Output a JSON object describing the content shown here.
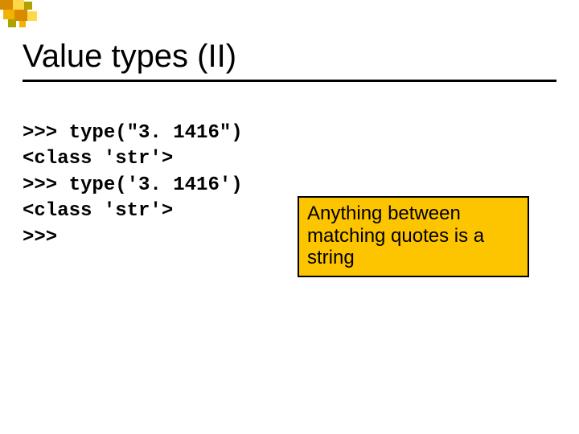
{
  "title": "Value types (II)",
  "code": {
    "line1": ">>> type(\"3. 1416\")",
    "line2": "<class 'str'>",
    "line3": ">>> type('3. 1416')",
    "line4": "<class 'str'>",
    "line5": ">>>"
  },
  "callout": {
    "text": "Anything between matching quotes is a string"
  },
  "decor_colors": {
    "orange": "#d88a00",
    "gold": "#f2b200",
    "yellow": "#ffd84a",
    "olive": "#b0a000"
  }
}
